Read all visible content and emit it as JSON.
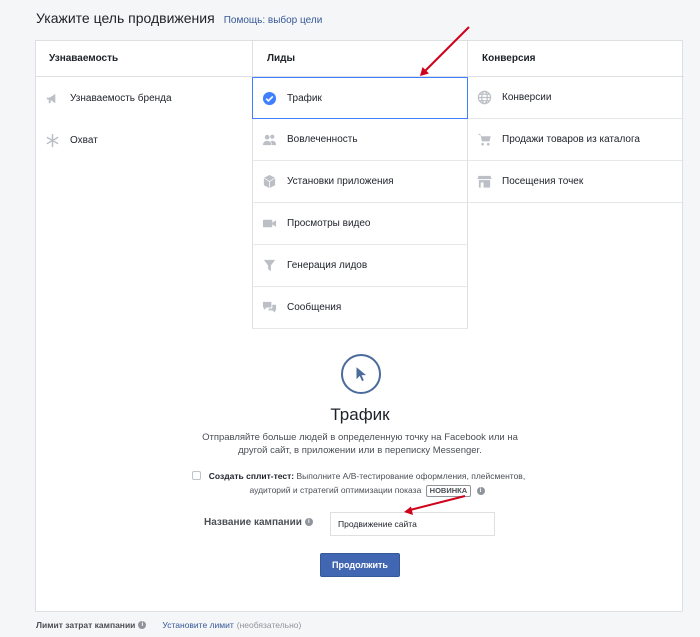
{
  "header": {
    "title": "Укажите цель продвижения",
    "help_link": "Помощь: выбор цели"
  },
  "columns": [
    {
      "heading": "Узнаваемость",
      "items": [
        {
          "label": "Узнаваемость бренда",
          "icon": "megaphone-icon"
        },
        {
          "label": "Охват",
          "icon": "snowflake-icon"
        }
      ]
    },
    {
      "heading": "Лиды",
      "items": [
        {
          "label": "Трафик",
          "icon": "check-circle-icon",
          "selected": true
        },
        {
          "label": "Вовлеченность",
          "icon": "people-icon"
        },
        {
          "label": "Установки приложения",
          "icon": "box-icon"
        },
        {
          "label": "Просмотры видео",
          "icon": "video-camera-icon"
        },
        {
          "label": "Генерация лидов",
          "icon": "filter-icon"
        },
        {
          "label": "Сообщения",
          "icon": "chat-bubbles-icon"
        }
      ]
    },
    {
      "heading": "Конверсия",
      "items": [
        {
          "label": "Конверсии",
          "icon": "globe-icon"
        },
        {
          "label": "Продажи товаров из каталога",
          "icon": "shopping-cart-icon"
        },
        {
          "label": "Посещения точек",
          "icon": "store-icon"
        }
      ]
    }
  ],
  "objective": {
    "icon": "cursor-icon",
    "title": "Трафик",
    "description": "Отправляйте больше людей в определенную точку на Facebook или на другой сайт, в приложении или в переписку Messenger."
  },
  "split_test": {
    "label": "Создать сплит-тест:",
    "description": "Выполните A/B-тестирование оформления, плейсментов, аудиторий и стратегий оптимизации показа",
    "badge": "НОВИНКА",
    "checked": false
  },
  "campaign_name": {
    "label": "Название кампании",
    "value": "Продвижение сайта"
  },
  "continue_button": "Продолжить",
  "footer": {
    "label": "Лимит затрат кампании",
    "link": "Установите лимит",
    "note": "(необязательно)"
  },
  "colors": {
    "accent": "#4267b2",
    "selected_border": "#4080ff",
    "annotation_arrow": "#d0021b"
  }
}
